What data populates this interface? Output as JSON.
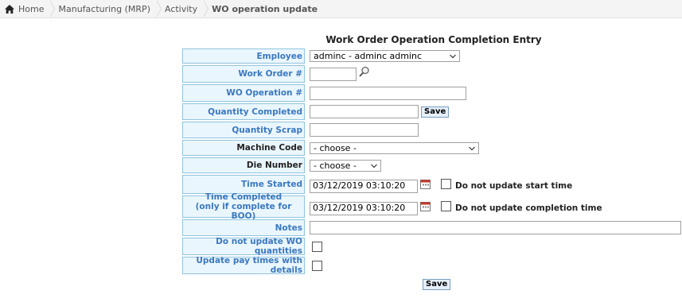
{
  "breadcrumb": {
    "home": "Home",
    "module": "Manufacturing (MRP)",
    "section": "Activity",
    "current": "WO operation update"
  },
  "form": {
    "title": "Work Order Operation Completion Entry",
    "employee": {
      "label": "Employee",
      "value": "adminc - adminc adminc"
    },
    "work_order": {
      "label": "Work Order #",
      "value": ""
    },
    "wo_operation": {
      "label": "WO Operation #",
      "value": ""
    },
    "qty_completed": {
      "label": "Quantity Completed",
      "value": "",
      "save_label": "Save"
    },
    "qty_scrap": {
      "label": "Quantity Scrap",
      "value": ""
    },
    "machine_code": {
      "label": "Machine Code",
      "value": "- choose -"
    },
    "die_number": {
      "label": "Die Number",
      "value": "- choose -"
    },
    "time_started": {
      "label": "Time Started",
      "value": "03/12/2019 03:10:20",
      "checkbox_label": "Do not update start time"
    },
    "time_completed": {
      "label_line1": "Time Completed",
      "label_line2": "(only if complete for BOO)",
      "value": "03/12/2019 03:10:20",
      "checkbox_label": "Do not update completion time"
    },
    "notes": {
      "label": "Notes",
      "value": ""
    },
    "no_update_wo_qty": {
      "label": "Do not update WO quantities"
    },
    "update_pay_times": {
      "label": "Update pay times with details"
    },
    "save_label": "Save"
  }
}
